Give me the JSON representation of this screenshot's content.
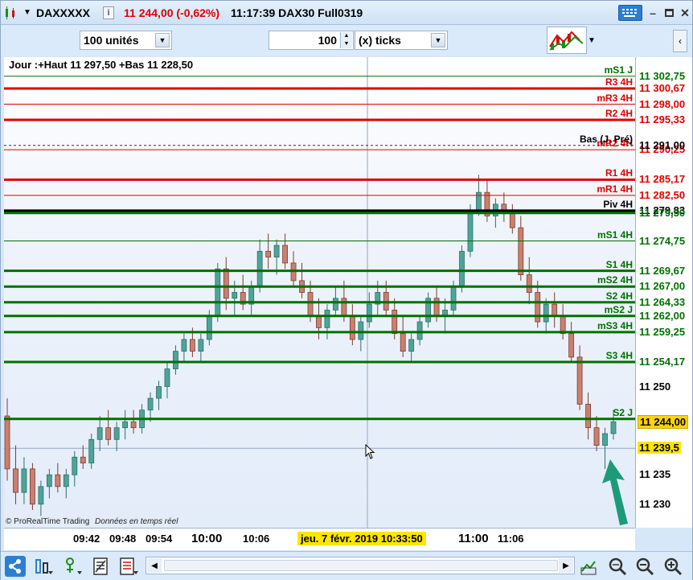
{
  "titlebar": {
    "symbol": "DAXXXXX",
    "info_icon": "info-icon",
    "price_change": "11 244,00 (-0,62%)",
    "time_and_instrument": "11:17:39 DAX30 Full0319"
  },
  "toolbar": {
    "units_value": "100 unités",
    "quantity_value": "100",
    "ticks_value": "(x) ticks"
  },
  "chart": {
    "header": "Jour :+Haut 11 297,50 +Bas 11 228,50",
    "footer_brand": "© ProRealTime Trading",
    "footer_note": "Données en temps réel",
    "price_min": 11226,
    "price_max": 11306,
    "levels": [
      {
        "name": "mS1 J",
        "price": 11302.75,
        "color": "#007000",
        "thick": false,
        "axis_label": "11 302,75"
      },
      {
        "name": "R3 4H",
        "price": 11300.67,
        "color": "#e00000",
        "thick": true,
        "axis_label": "11 300,67"
      },
      {
        "name": "mR3 4H",
        "price": 11298.0,
        "color": "#e00000",
        "thick": false,
        "axis_label": "11 298,00"
      },
      {
        "name": "R2 4H",
        "price": 11295.33,
        "color": "#e00000",
        "thick": true,
        "axis_label": "11 295,33"
      },
      {
        "name": "mR2 4H",
        "price": 11290.25,
        "color": "#e00000",
        "thick": false,
        "axis_label": "11 290,25"
      },
      {
        "name": "R1 4H",
        "price": 11285.17,
        "color": "#e00000",
        "thick": true,
        "axis_label": "11 285,17"
      },
      {
        "name": "mR1 4H",
        "price": 11282.5,
        "color": "#e00000",
        "thick": false,
        "axis_label": "11 282,50"
      },
      {
        "name": "Piv 4H",
        "price": 11279.83,
        "color": "#000000",
        "thick": true,
        "axis_label": "11 279,83"
      },
      {
        "name": "",
        "price": 11279.5,
        "color": "#007000",
        "thick": true,
        "axis_label": "11 279,50"
      },
      {
        "name": "mS1 4H",
        "price": 11274.75,
        "color": "#007000",
        "thick": false,
        "axis_label": "11 274,75"
      },
      {
        "name": "S1 4H",
        "price": 11269.67,
        "color": "#007000",
        "thick": true,
        "axis_label": "11 269,67"
      },
      {
        "name": "mS2 4H",
        "price": 11267.0,
        "color": "#007000",
        "thick": true,
        "axis_label": "11 267,00"
      },
      {
        "name": "S2 4H",
        "price": 11264.33,
        "color": "#007000",
        "thick": true,
        "axis_label": "11 264,33"
      },
      {
        "name": "mS2 J",
        "price": 11262.0,
        "color": "#007000",
        "thick": true,
        "axis_label": "11 262,00"
      },
      {
        "name": "mS3 4H",
        "price": 11259.25,
        "color": "#007000",
        "thick": true,
        "axis_label": "11 259,25"
      },
      {
        "name": "S3 4H",
        "price": 11254.17,
        "color": "#007000",
        "thick": true,
        "axis_label": "11 254,17"
      },
      {
        "name": "S2 J",
        "price": 11244.5,
        "color": "#007000",
        "thick": true,
        "axis_label": "11 244,50"
      }
    ],
    "bas_label": "Bas (J. Pré)",
    "bas_price": 11291.0,
    "bas_axis_label": "11 291,00",
    "current_price_label": "11 244,00",
    "cursor_price_label": "11 239,5",
    "cursor_price": 11239.5,
    "axis_ticks": [
      {
        "label": "11 250",
        "price": 11250
      },
      {
        "label": "11 235",
        "price": 11235
      },
      {
        "label": "11 230",
        "price": 11230
      }
    ],
    "time_labels": [
      "09:42",
      "09:48",
      "09:54",
      "10:00",
      "10:06",
      "11:00",
      "11:06"
    ],
    "cursor_time_label": "jeu. 7 févr. 2019 10:33:50",
    "candles": [
      [
        11245,
        11248,
        11234,
        11236
      ],
      [
        11236,
        11240,
        11230,
        11232
      ],
      [
        11232,
        11238,
        11230,
        11236
      ],
      [
        11236,
        11237,
        11229,
        11230
      ],
      [
        11230,
        11234,
        11228,
        11233
      ],
      [
        11233,
        11236,
        11231,
        11235
      ],
      [
        11235,
        11237,
        11232,
        11233
      ],
      [
        11233,
        11236,
        11231,
        11235
      ],
      [
        11235,
        11239,
        11233,
        11238
      ],
      [
        11238,
        11240,
        11236,
        11237
      ],
      [
        11237,
        11242,
        11236,
        11241
      ],
      [
        11241,
        11245,
        11239,
        11243
      ],
      [
        11243,
        11246,
        11240,
        11241
      ],
      [
        11241,
        11244,
        11239,
        11243
      ],
      [
        11243,
        11246,
        11241,
        11244
      ],
      [
        11244,
        11246,
        11242,
        11243
      ],
      [
        11243,
        11247,
        11242,
        11246
      ],
      [
        11246,
        11249,
        11244,
        11248
      ],
      [
        11248,
        11251,
        11246,
        11250
      ],
      [
        11250,
        11254,
        11248,
        11253
      ],
      [
        11253,
        11257,
        11252,
        11256
      ],
      [
        11256,
        11259,
        11254,
        11258
      ],
      [
        11258,
        11260,
        11255,
        11256
      ],
      [
        11256,
        11259,
        11254,
        11258
      ],
      [
        11258,
        11263,
        11257,
        11262
      ],
      [
        11262,
        11271,
        11261,
        11270
      ],
      [
        11270,
        11272,
        11263,
        11265
      ],
      [
        11265,
        11268,
        11262,
        11266
      ],
      [
        11266,
        11269,
        11263,
        11264
      ],
      [
        11264,
        11268,
        11262,
        11267
      ],
      [
        11267,
        11275,
        11266,
        11273
      ],
      [
        11273,
        11276,
        11270,
        11272
      ],
      [
        11272,
        11275,
        11269,
        11274
      ],
      [
        11274,
        11276,
        11270,
        11271
      ],
      [
        11271,
        11273,
        11267,
        11268
      ],
      [
        11268,
        11271,
        11265,
        11266
      ],
      [
        11266,
        11268,
        11261,
        11262
      ],
      [
        11262,
        11265,
        11258,
        11260
      ],
      [
        11260,
        11264,
        11258,
        11263
      ],
      [
        11263,
        11267,
        11262,
        11265
      ],
      [
        11265,
        11268,
        11261,
        11262
      ],
      [
        11262,
        11264,
        11257,
        11258
      ],
      [
        11258,
        11262,
        11256,
        11261
      ],
      [
        11261,
        11266,
        11260,
        11264
      ],
      [
        11264,
        11268,
        11262,
        11266
      ],
      [
        11266,
        11268,
        11262,
        11263
      ],
      [
        11263,
        11265,
        11258,
        11259
      ],
      [
        11259,
        11262,
        11255,
        11256
      ],
      [
        11256,
        11259,
        11254,
        11258
      ],
      [
        11258,
        11262,
        11257,
        11261
      ],
      [
        11261,
        11266,
        11260,
        11265
      ],
      [
        11265,
        11267,
        11261,
        11262
      ],
      [
        11262,
        11265,
        11259,
        11263
      ],
      [
        11263,
        11268,
        11262,
        11267
      ],
      [
        11267,
        11274,
        11266,
        11273
      ],
      [
        11273,
        11281,
        11272,
        11280
      ],
      [
        11280,
        11286,
        11279,
        11283
      ],
      [
        11283,
        11285,
        11278,
        11279
      ],
      [
        11279,
        11282,
        11277,
        11281
      ],
      [
        11281,
        11283,
        11278,
        11280
      ],
      [
        11280,
        11281,
        11276,
        11277
      ],
      [
        11277,
        11279,
        11268,
        11269
      ],
      [
        11269,
        11272,
        11264,
        11266
      ],
      [
        11266,
        11268,
        11260,
        11261
      ],
      [
        11261,
        11265,
        11259,
        11264
      ],
      [
        11264,
        11266,
        11260,
        11262
      ],
      [
        11262,
        11264,
        11258,
        11259
      ],
      [
        11259,
        11261,
        11254,
        11255
      ],
      [
        11255,
        11257,
        11246,
        11247
      ],
      [
        11247,
        11249,
        11241,
        11243
      ],
      [
        11243,
        11245,
        11239,
        11240
      ],
      [
        11240,
        11243,
        11236,
        11242
      ],
      [
        11242,
        11246,
        11241,
        11244
      ]
    ]
  }
}
